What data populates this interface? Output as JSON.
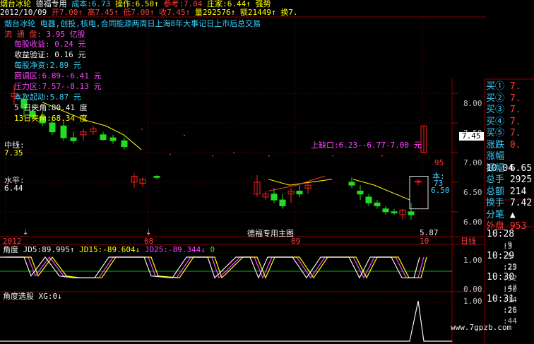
{
  "header": {
    "name": "烟台冰轮",
    "mode": "德福专用",
    "cost_label": "成本:",
    "cost": "6.73",
    "op_label": "操作:",
    "op": "6.50↑",
    "ref_label": "参考:",
    "ref": "7.04",
    "dealer_label": "庄家:",
    "dealer": "6.44↑",
    "strong_label": "强势",
    "date": "2012/10/09",
    "open_label": "开",
    "open": "7.00↑",
    "high_label": "高",
    "high": "7.45↑",
    "low_label": "低",
    "low": "7.00↑",
    "close_label": "收",
    "close": "7.45↑",
    "vol_label": "量",
    "vol": "292576↑",
    "amt_label": "额",
    "amt": "21449↑",
    "turn_label": "换",
    "turn": "7."
  },
  "info": {
    "line1": "烟台冰轮  电器,创投,核电,合同能源两周日上海8年大事记日上市后总交易",
    "float_label": "流  通  盘:",
    "float_val": "3.95 亿股",
    "eps_label": "每股收益:",
    "eps_val": "0.24  元",
    "cum_label": "收益验证:",
    "cum_val": "0.16  元",
    "nav_label": "每股净资:",
    "nav_val": "2.89 元",
    "back_label": "回调区:",
    "back_val": "6.89--6.41 元",
    "press_label": "压力区:",
    "press_val": "7.57--8.13 元",
    "start_label": "本次起动:",
    "start_val": "5.87 元",
    "ang5_label": "5 日夹角:",
    "ang5_val": "80.41 度",
    "ang13_label": "13日夹角:",
    "ang13_val": "68.34 度",
    "mid_label": "中线:",
    "mid_val": "7.35",
    "level_label": "水平:",
    "level_val": "6.44",
    "gap_text": "上缺口:6.23--6.77-7.00 元",
    "low_price": "5.87",
    "chart_title": "德福专用主图"
  },
  "axis": {
    "prices": [
      "8.00",
      "7.50",
      "7.00",
      "6.50",
      "6.00"
    ],
    "price_tag": "7.45",
    "months": [
      "2012",
      "08",
      "09",
      "10"
    ],
    "period": "日线",
    "side_mini": [
      "95",
      "本:",
      "73",
      "6.50"
    ],
    "angle_scale": [
      "1.00",
      "0.00"
    ],
    "sel_scale": [
      "1.00"
    ]
  },
  "indicator": {
    "name": "角度",
    "jd5": "JD5:89.995↑",
    "jd15": "JD15:-89.604↓",
    "jd25": "JD25:-89.344↓",
    "extra": "0"
  },
  "selector": {
    "name": "角度选股",
    "xg": "XG:0↓"
  },
  "watermark": "www.7gpzb.com",
  "quote": {
    "rows": [
      {
        "label": "买①",
        "value": "7."
      },
      {
        "label": "买②",
        "value": "7."
      },
      {
        "label": "买③",
        "value": "7."
      },
      {
        "label": "买④",
        "value": "7."
      },
      {
        "label": "买⑤",
        "value": "7."
      },
      {
        "label": "涨跌",
        "value": "0."
      },
      {
        "label": "涨幅",
        "value": "10.04"
      },
      {
        "label": "振幅",
        "value": "6.65"
      },
      {
        "label": "总手",
        "value": "2925"
      },
      {
        "label": "总额",
        "value": "214"
      },
      {
        "label": "换手",
        "value": "7.42"
      },
      {
        "label": "分笔",
        "value": "▲"
      },
      {
        "label": "外盘",
        "value": "953"
      }
    ],
    "times": [
      {
        "t": "10:28",
        "s": ":9"
      },
      {
        "t": "10:29",
        "s": ":29"
      },
      {
        "t": "10:30",
        "s": ":47"
      },
      {
        "t": "10:31",
        "s": ":26"
      }
    ],
    "tick_marks": [
      ":3",
      ":5",
      ":23",
      ":32",
      ":50",
      ":14",
      ":26",
      ":44"
    ]
  },
  "chart_data": {
    "type": "candlestick",
    "title": "德福专用主图",
    "ylim": [
      5.7,
      8.3
    ],
    "x": [
      "2012",
      "08",
      "09",
      "10"
    ],
    "price_ticks": [
      8.0,
      7.5,
      7.0,
      6.5,
      6.0
    ]
  }
}
